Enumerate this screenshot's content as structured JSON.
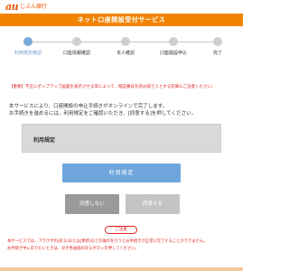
{
  "brand": {
    "mark": "au",
    "name": "じぶん銀行",
    "color": "#eb5505"
  },
  "header": {
    "title": "ネット口座開設受付サービス",
    "bg": "#f08300"
  },
  "steps": [
    {
      "label": "利用規定確認",
      "active": true
    },
    {
      "label": "口座情報確認",
      "active": false
    },
    {
      "label": "本人確認",
      "active": false
    },
    {
      "label": "口座開設申込",
      "active": false
    },
    {
      "label": "完了",
      "active": false
    }
  ],
  "warning": "【重要】不正にポップアップ画面を表示させる等によって、暗証番号を読み取ろうとする犯罪にご注意ください。",
  "intro": {
    "line1": "本サービスにより、口座開設の申込手続きがオンラインで完了します。",
    "line2": "お手続きを進めるには、利用規定をご確認いただき、[同意する]を押してください。"
  },
  "terms": {
    "title": "利用規定"
  },
  "buttons": {
    "terms": "利用規定",
    "disagree": "同意しない",
    "agree": "同意する"
  },
  "note": {
    "label": "ご注意",
    "line1": "本サービスでは、ブラウザの[戻る]または[更新]などの操作を行うとお手続きが正常に完了することができません。",
    "line2": "お手続き中に戻りたいときは、必ず各画面の戻るボタンを押してください。"
  },
  "colors": {
    "accent": "#f08300",
    "primary_button": "#6ea5dc",
    "warning_text": "#e02020",
    "active_step": "#7aaad8"
  }
}
